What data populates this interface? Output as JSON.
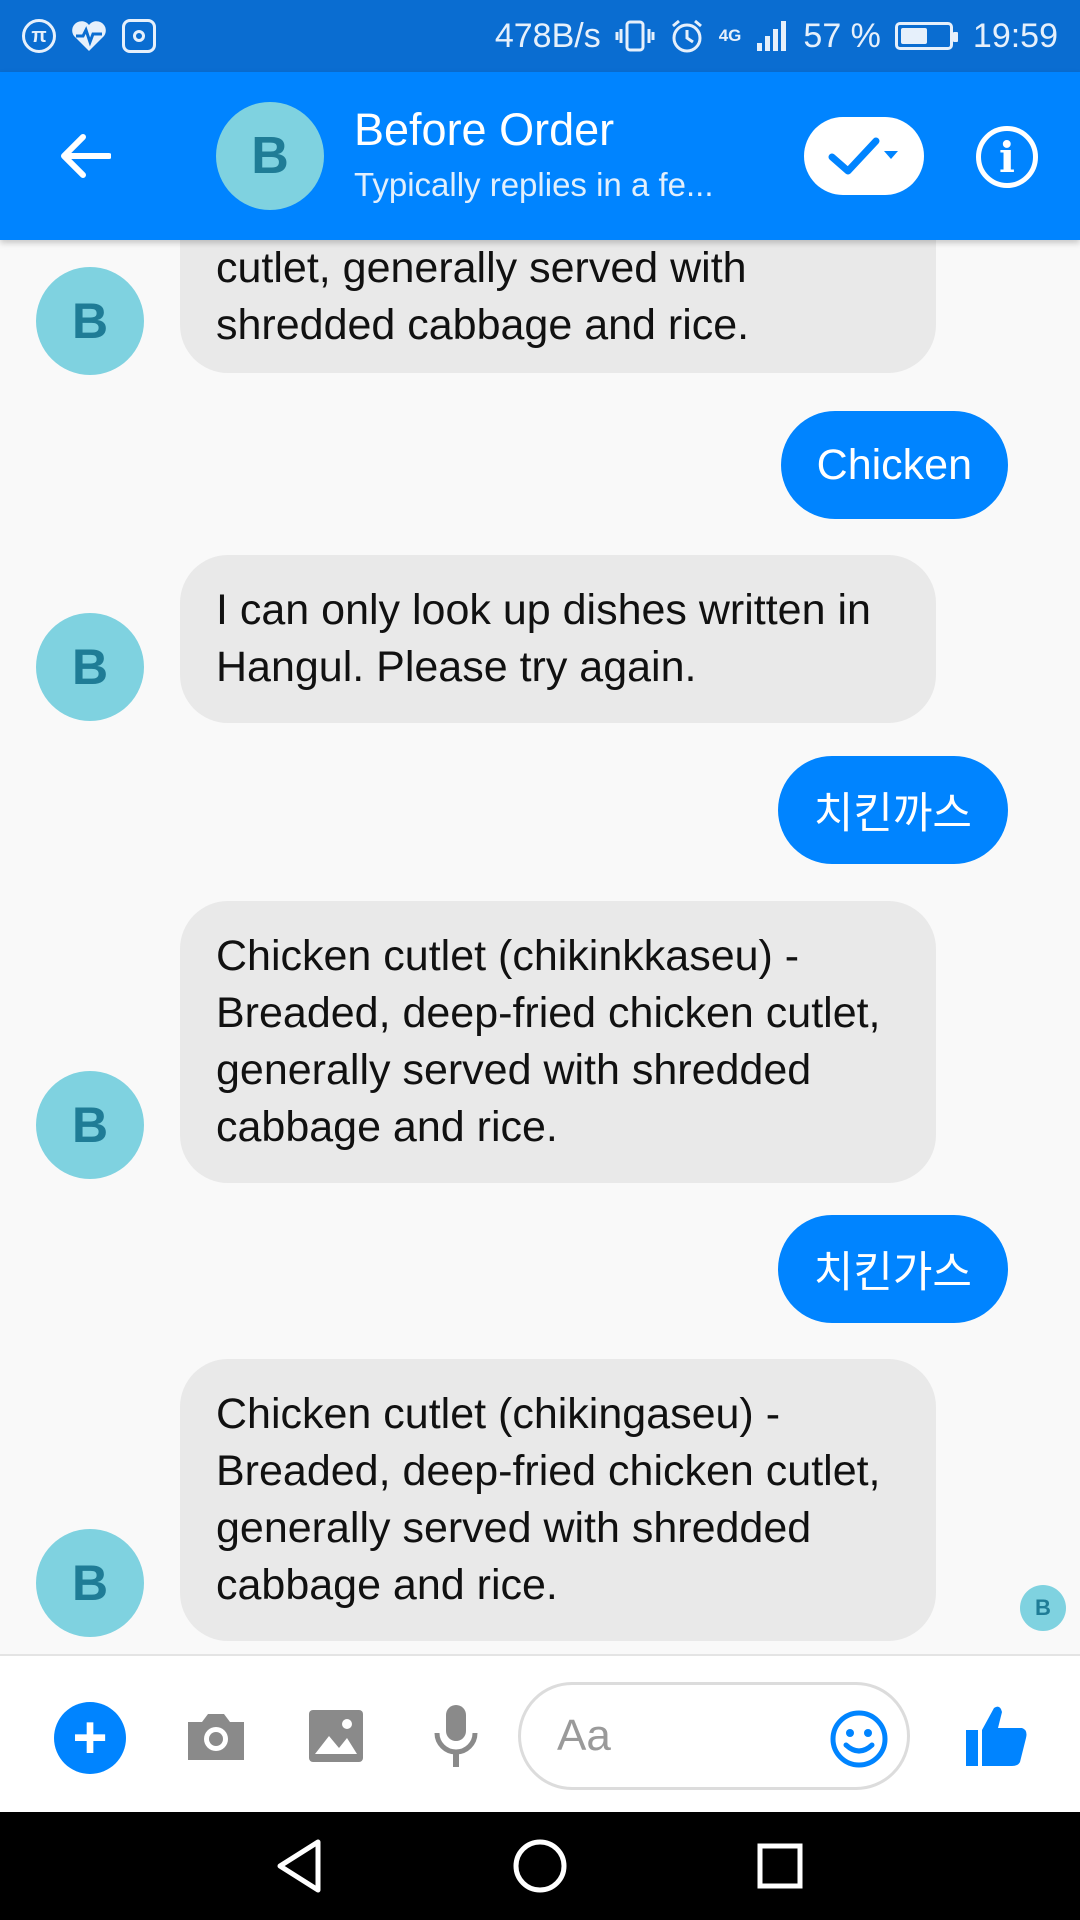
{
  "status_bar": {
    "left_icons": [
      "pi-icon",
      "heart-pulse-icon",
      "instagram-icon"
    ],
    "speed": "478B/s",
    "network": "4G",
    "battery_percent": "57 %",
    "battery_level": 0.57,
    "time": "19:59"
  },
  "header": {
    "avatar_letter": "B",
    "title": "Before Order",
    "subtitle": "Typically replies in a fe..."
  },
  "messages": [
    {
      "from": "bot",
      "text": "cutlet, generally served with shredded cabbage and rice."
    },
    {
      "from": "user",
      "text": "Chicken"
    },
    {
      "from": "bot",
      "text": "I can only look up dishes written in Hangul. Please try again."
    },
    {
      "from": "user",
      "text": "치킨까스"
    },
    {
      "from": "bot",
      "text": "Chicken cutlet (chikinkkaseu) - Breaded, deep-fried chicken cutlet, generally served with shredded cabbage and rice."
    },
    {
      "from": "user",
      "text": "치킨가스"
    },
    {
      "from": "bot",
      "text": "Chicken cutlet (chikingaseu) - Breaded, deep-fried chicken cutlet, generally served with shredded cabbage and rice."
    }
  ],
  "avatar_letter": "B",
  "seen_letter": "B",
  "composer": {
    "placeholder": "Aa"
  },
  "colors": {
    "brand": "#0084ff",
    "status_bar": "#0a6dd1",
    "avatar_bg": "#7fd2e0",
    "bubble_in": "#e9e9e9"
  }
}
